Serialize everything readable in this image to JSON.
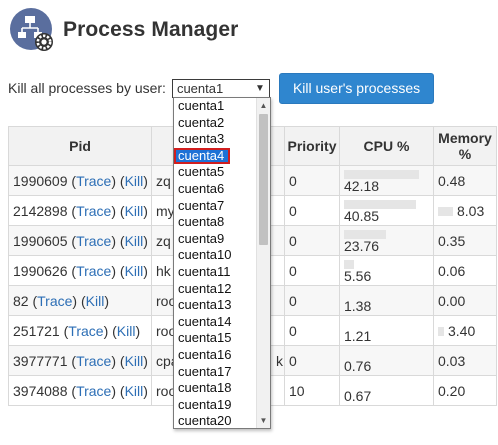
{
  "page": {
    "title": "Process Manager",
    "icon": "process-settings-icon"
  },
  "kill": {
    "label": "Kill all processes by user:",
    "selected_user": "cuenta1",
    "button": "Kill user's processes"
  },
  "table": {
    "headers": {
      "pid": "Pid",
      "user": "",
      "command": "",
      "priority": "Priority",
      "cpu": "CPU %",
      "memory": "Memory %"
    },
    "trace_label": "Trace",
    "kill_label": "Kill",
    "rows": [
      {
        "pid": "1990609",
        "user": "zq",
        "command": "",
        "priority": "0",
        "cpu": "42.18",
        "cpu_frac": 0.84,
        "memory": "0.48",
        "mem_frac": 0.0
      },
      {
        "pid": "2142898",
        "user": "my",
        "command": "",
        "priority": "0",
        "cpu": "40.85",
        "cpu_frac": 0.81,
        "memory": "8.03",
        "mem_frac": 0.3
      },
      {
        "pid": "1990605",
        "user": "zq",
        "command": "",
        "priority": "0",
        "cpu": "23.76",
        "cpu_frac": 0.47,
        "memory": "0.35",
        "mem_frac": 0.0
      },
      {
        "pid": "1990626",
        "user": "hk",
        "command": "",
        "priority": "0",
        "cpu": "5.56",
        "cpu_frac": 0.11,
        "memory": "0.06",
        "mem_frac": 0.0
      },
      {
        "pid": "82",
        "user": "roo",
        "command": "",
        "priority": "0",
        "cpu": "1.38",
        "cpu_frac": 0.0,
        "memory": "0.00",
        "mem_frac": 0.0
      },
      {
        "pid": "251721",
        "user": "roo",
        "command": "",
        "priority": "0",
        "cpu": "1.21",
        "cpu_frac": 0.0,
        "memory": "3.40",
        "mem_frac": 0.12
      },
      {
        "pid": "3977771",
        "user": "cpa",
        "command": "k",
        "priority": "0",
        "cpu": "0.76",
        "cpu_frac": 0.0,
        "memory": "0.03",
        "mem_frac": 0.0
      },
      {
        "pid": "3974088",
        "user": "roo",
        "command": "",
        "priority": "10",
        "cpu": "0.67",
        "cpu_frac": 0.0,
        "memory": "0.20",
        "mem_frac": 0.0
      }
    ]
  },
  "dropdown": {
    "options": [
      "cuenta1",
      "cuenta2",
      "cuenta3",
      "cuenta4",
      "cuenta5",
      "cuenta6",
      "cuenta7",
      "cuenta8",
      "cuenta9",
      "cuenta10",
      "cuenta11",
      "cuenta12",
      "cuenta13",
      "cuenta14",
      "cuenta15",
      "cuenta16",
      "cuenta17",
      "cuenta18",
      "cuenta19",
      "cuenta20"
    ],
    "highlighted": "cuenta4"
  },
  "colors": {
    "accent": "#2f86cf",
    "link": "#2c6eb5",
    "highlight": "#1e72d6",
    "highlight_border": "#d11e1e"
  }
}
